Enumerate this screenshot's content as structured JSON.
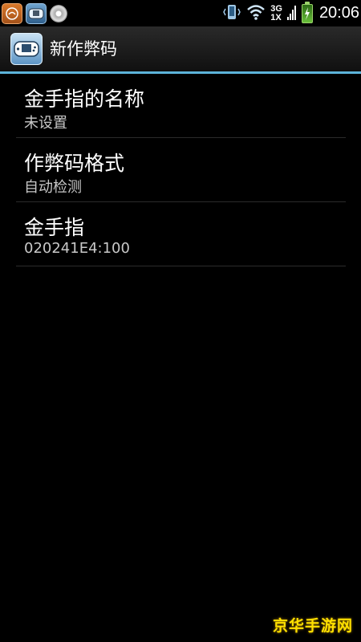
{
  "status_bar": {
    "time": "20:06",
    "network_top": "3G",
    "network_bottom": "1X",
    "icons": [
      "fire-app-notification-icon",
      "gba-emulator-notification-icon",
      "disk-usage-icon",
      "vibrate-icon",
      "wifi-icon",
      "signal-icon",
      "battery-charging-icon"
    ]
  },
  "title_bar": {
    "title": "新作弊码",
    "icon": "gba-emulator-app-icon"
  },
  "preferences": [
    {
      "title": "金手指的名称",
      "summary": "未设置"
    },
    {
      "title": "作弊码格式",
      "summary": "自动检测"
    },
    {
      "title": "金手指",
      "summary": "020241E4:100"
    }
  ],
  "watermark": "京华手游网",
  "colors": {
    "accent_divider": "#5cb3d9",
    "background": "#000000",
    "battery": "#69c03b",
    "watermark": "#ffe000"
  }
}
